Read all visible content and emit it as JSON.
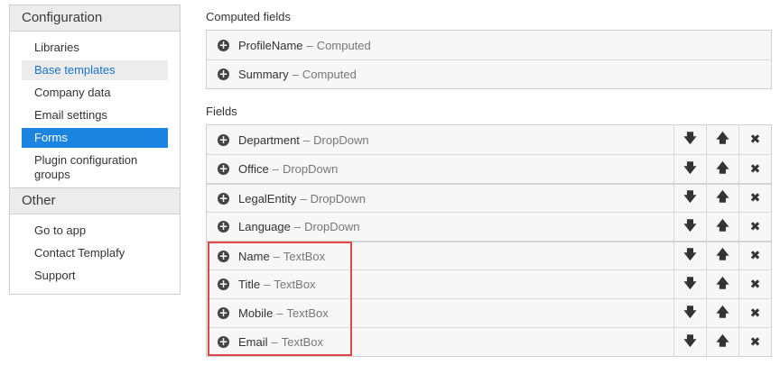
{
  "sidebar": {
    "configuration": {
      "title": "Configuration",
      "items": [
        {
          "label": "Libraries"
        },
        {
          "label": "Base templates"
        },
        {
          "label": "Company data"
        },
        {
          "label": "Email settings"
        },
        {
          "label": "Forms"
        },
        {
          "label": "Plugin configuration groups"
        }
      ],
      "hover_item": "Base templates",
      "active_item": "Forms"
    },
    "other": {
      "title": "Other",
      "items": [
        {
          "label": "Go to app"
        },
        {
          "label": "Contact Templafy"
        },
        {
          "label": "Support"
        }
      ]
    }
  },
  "computed_fields": {
    "title": "Computed fields",
    "items": [
      {
        "name": "ProfileName",
        "type": "Computed"
      },
      {
        "name": "Summary",
        "type": "Computed"
      }
    ]
  },
  "fields": {
    "title": "Fields",
    "separator": "–",
    "items": [
      {
        "name": "Department",
        "type": "DropDown"
      },
      {
        "name": "Office",
        "type": "DropDown"
      },
      {
        "name": "LegalEntity",
        "type": "DropDown"
      },
      {
        "name": "Language",
        "type": "DropDown"
      },
      {
        "name": "Name",
        "type": "TextBox"
      },
      {
        "name": "Title",
        "type": "TextBox"
      },
      {
        "name": "Mobile",
        "type": "TextBox"
      },
      {
        "name": "Email",
        "type": "TextBox"
      }
    ]
  },
  "icons": {
    "expand": "plus-circle-icon",
    "move_down": "arrow-down-icon",
    "move_up": "arrow-up-icon",
    "remove": "close-icon"
  },
  "colors": {
    "accent": "#1a84e0",
    "hover_text": "#1a73c9",
    "highlight": "#e04747"
  }
}
